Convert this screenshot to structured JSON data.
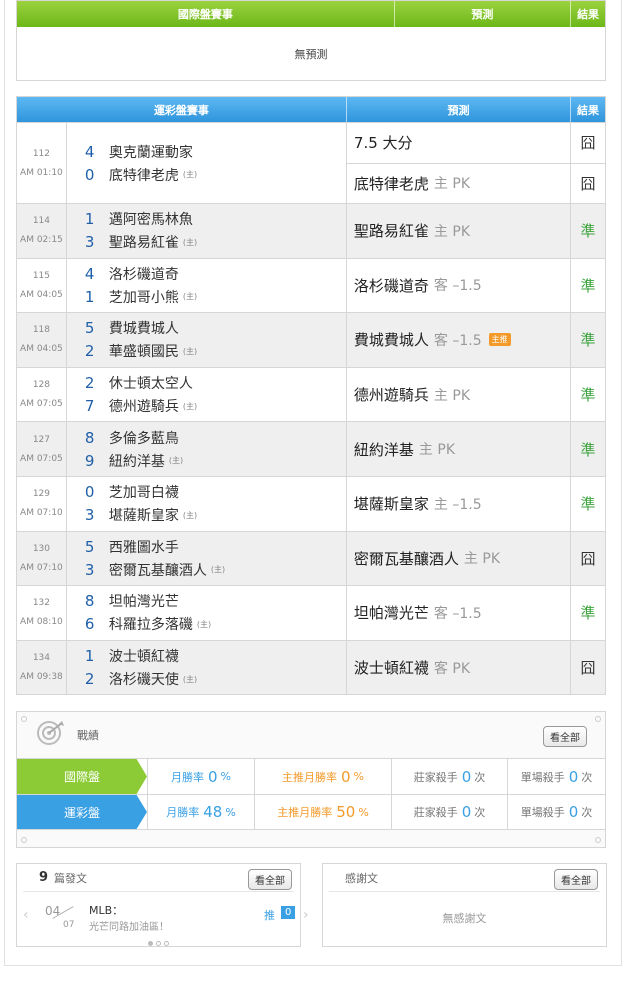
{
  "intl": {
    "header": {
      "game": "國際盤賽事",
      "pred": "預測",
      "result": "結果"
    },
    "empty": "無預測"
  },
  "sport": {
    "header": {
      "game": "運彩盤賽事",
      "pred": "預測",
      "result": "結果"
    },
    "host_mark": "(主)",
    "rows": [
      {
        "id": "112",
        "time": "AM 01:10",
        "away": "奧克蘭運動家",
        "away_score": "4",
        "home": "底特律老虎",
        "home_score": "0",
        "preds": [
          {
            "main": "7.5 大分",
            "sub": "",
            "result": "囧",
            "win": false
          },
          {
            "main": "底特律老虎",
            "sub": "主 PK",
            "result": "囧",
            "win": false
          }
        ]
      },
      {
        "id": "114",
        "time": "AM 02:15",
        "away": "邁阿密馬林魚",
        "away_score": "1",
        "home": "聖路易紅雀",
        "home_score": "3",
        "preds": [
          {
            "main": "聖路易紅雀",
            "sub": "主 PK",
            "result": "準",
            "win": true
          }
        ]
      },
      {
        "id": "115",
        "time": "AM 04:05",
        "away": "洛杉磯道奇",
        "away_score": "4",
        "home": "芝加哥小熊",
        "home_score": "1",
        "preds": [
          {
            "main": "洛杉磯道奇",
            "sub": "客 –1.5",
            "result": "準",
            "win": true
          }
        ]
      },
      {
        "id": "118",
        "time": "AM 04:05",
        "away": "費城費城人",
        "away_score": "5",
        "home": "華盛頓國民",
        "home_score": "2",
        "preds": [
          {
            "main": "費城費城人",
            "sub": "客 –1.5",
            "badge": "主推",
            "result": "準",
            "win": true
          }
        ]
      },
      {
        "id": "128",
        "time": "AM 07:05",
        "away": "休士頓太空人",
        "away_score": "2",
        "home": "德州遊騎兵",
        "home_score": "7",
        "preds": [
          {
            "main": "德州遊騎兵",
            "sub": "主 PK",
            "result": "準",
            "win": true
          }
        ]
      },
      {
        "id": "127",
        "time": "AM 07:05",
        "away": "多倫多藍鳥",
        "away_score": "8",
        "home": "紐約洋基",
        "home_score": "9",
        "preds": [
          {
            "main": "紐約洋基",
            "sub": "主 PK",
            "result": "準",
            "win": true
          }
        ]
      },
      {
        "id": "129",
        "time": "AM 07:10",
        "away": "芝加哥白襪",
        "away_score": "0",
        "home": "堪薩斯皇家",
        "home_score": "3",
        "preds": [
          {
            "main": "堪薩斯皇家",
            "sub": "主 –1.5",
            "result": "準",
            "win": true
          }
        ]
      },
      {
        "id": "130",
        "time": "AM 07:10",
        "away": "西雅圖水手",
        "away_score": "5",
        "home": "密爾瓦基釀酒人",
        "home_score": "3",
        "preds": [
          {
            "main": "密爾瓦基釀酒人",
            "sub": "主 PK",
            "result": "囧",
            "win": false
          }
        ]
      },
      {
        "id": "132",
        "time": "AM 08:10",
        "away": "坦帕灣光芒",
        "away_score": "8",
        "home": "科羅拉多落磯",
        "home_score": "6",
        "preds": [
          {
            "main": "坦帕灣光芒",
            "sub": "客 –1.5",
            "result": "準",
            "win": true
          }
        ]
      },
      {
        "id": "134",
        "time": "AM 09:38",
        "away": "波士頓紅襪",
        "away_score": "1",
        "home": "洛杉磯天使",
        "home_score": "2",
        "preds": [
          {
            "main": "波士頓紅襪",
            "sub": "客 PK",
            "result": "囧",
            "win": false
          }
        ]
      }
    ]
  },
  "record": {
    "title": "戰績",
    "see_all": "看全部",
    "rows": [
      {
        "label": "國際盤",
        "win_rate_label": "月勝率",
        "win_rate": "0",
        "top_rate_label": "主推月勝率",
        "top_rate": "0",
        "killer_label": "莊家殺手",
        "killer": "0",
        "single_label": "單場殺手",
        "single": "0",
        "pct": "%",
        "times": "次"
      },
      {
        "label": "運彩盤",
        "win_rate_label": "月勝率",
        "win_rate": "48",
        "top_rate_label": "主推月勝率",
        "top_rate": "50",
        "killer_label": "莊家殺手",
        "killer": "0",
        "single_label": "單場殺手",
        "single": "0",
        "pct": "%",
        "times": "次"
      }
    ]
  },
  "posts": {
    "count": "9",
    "label": "篇發文",
    "see_all": "看全部",
    "item": {
      "month": "04",
      "day": "07",
      "title1": "MLB：",
      "title2": "光芒同路加油區！",
      "push_label": "推",
      "push_count": "0"
    }
  },
  "thanks": {
    "label": "感謝文",
    "see_all": "看全部",
    "empty": "無感謝文"
  },
  "colors": {
    "green": "#8ccb35",
    "blue": "#3aa0e4",
    "orange": "#f39a2a",
    "win": "#3da33d"
  }
}
